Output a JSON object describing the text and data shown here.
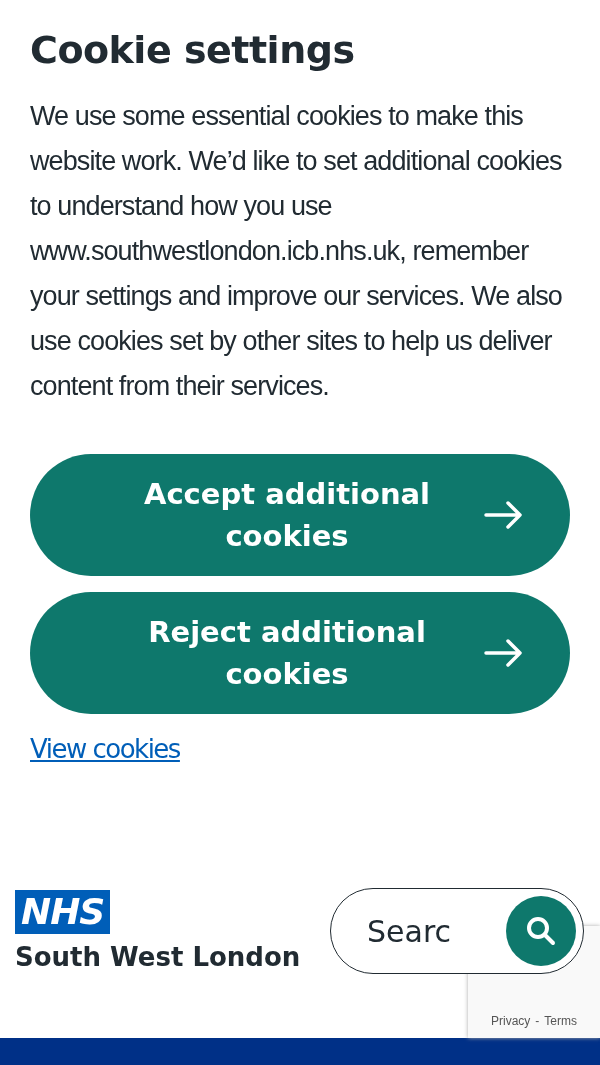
{
  "cookie_banner": {
    "title": "Cookie settings",
    "text": "We use some essential cookies to make this website work. We’d like to set additional cookies to understand how you use www.southwestlondon.icb.nhs.uk, remember your settings and improve our services. We also use cookies set by other sites to help us deliver content from their services.",
    "buttons": [
      {
        "label": "Accept additional cookies"
      },
      {
        "label": "Reject additional cookies"
      }
    ],
    "link": "View cookies"
  },
  "header": {
    "logo_badge": "NHS",
    "logo_text": "South West London",
    "search": {
      "placeholder": "Searc"
    }
  },
  "recaptcha": {
    "links": [
      "Privacy",
      "Terms"
    ],
    "separator": "-"
  }
}
